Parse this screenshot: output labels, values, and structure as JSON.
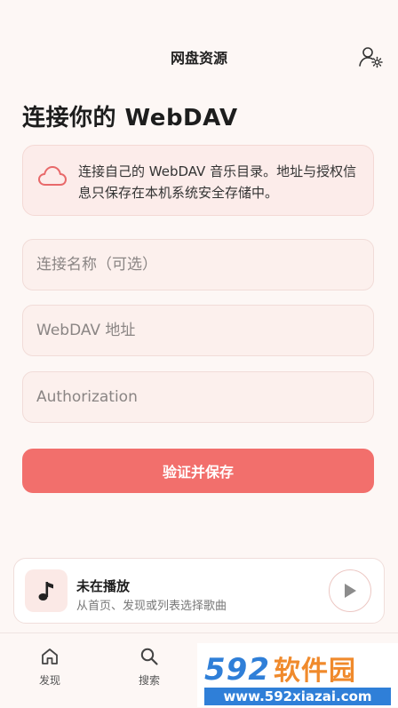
{
  "topbar": {
    "title": "网盘资源",
    "account_icon": "user-settings-icon"
  },
  "heading": "连接你的 WebDAV",
  "info": {
    "icon": "cloud-icon",
    "text": "连接自己的 WebDAV 音乐目录。地址与授权信息只保存在本机系统安全存储中。"
  },
  "form": {
    "name_placeholder": "连接名称（可选）",
    "name_value": "",
    "url_placeholder": "WebDAV 地址",
    "url_value": "",
    "auth_placeholder": "Authorization",
    "auth_value": "",
    "submit_label": "验证并保存"
  },
  "player": {
    "title": "未在播放",
    "subtitle": "从首页、发现或列表选择歌曲",
    "art_icon": "music-note-icon",
    "play_icon": "play-icon"
  },
  "tabs": [
    {
      "label": "发现",
      "icon": "home-icon"
    },
    {
      "label": "搜索",
      "icon": "search-icon"
    }
  ],
  "watermark": {
    "brand_number": "592",
    "brand_text": "软件园",
    "url": "www.592xiazai.com"
  },
  "colors": {
    "accent": "#f26f6c",
    "background": "#fdf7f5",
    "card": "#fcecea"
  }
}
